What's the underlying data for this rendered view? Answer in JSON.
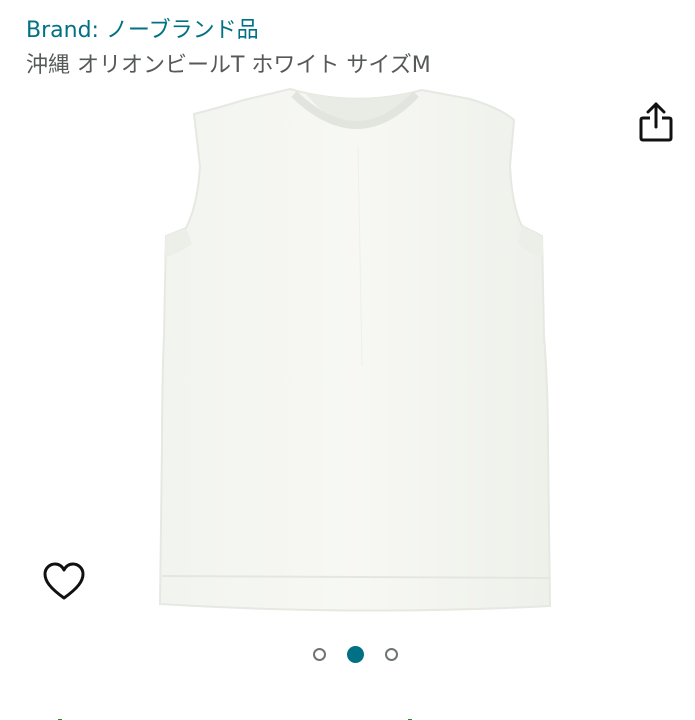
{
  "header": {
    "brand_label": "Brand: ノーブランド品",
    "product_title": "沖縄 オリオンビールT ホワイト サイズM"
  },
  "icons": {
    "share": "share-icon",
    "wishlist": "heart-icon"
  },
  "carousel": {
    "image_subject": "white sleeveless t-shirt",
    "dot_count": 3,
    "active_index": 1
  },
  "colors": {
    "link": "#007185",
    "text_secondary": "#565959",
    "accent": "#007185",
    "green_partial": "#1a8f2e"
  }
}
